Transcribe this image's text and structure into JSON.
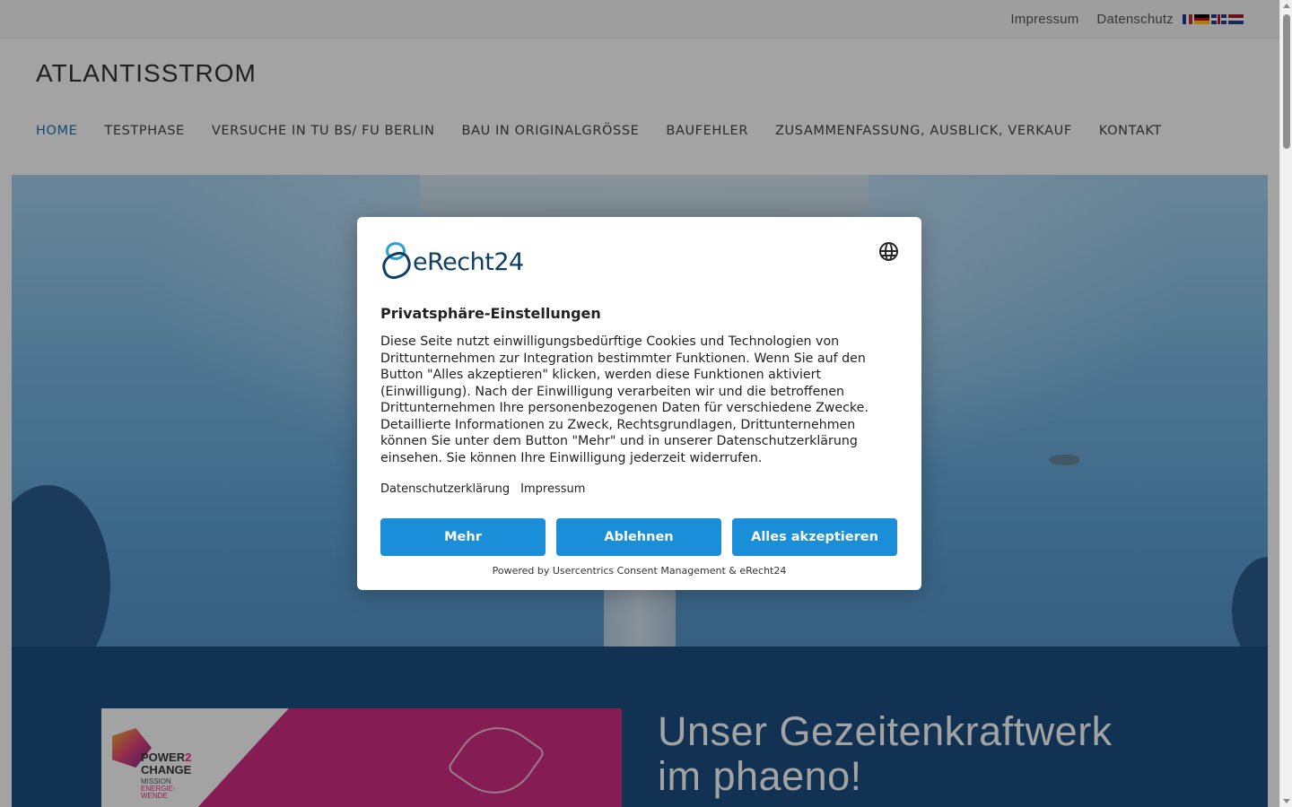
{
  "topbar": {
    "links": [
      "Impressum",
      "Datenschutz"
    ],
    "languages": [
      "fr",
      "de",
      "en",
      "nl"
    ]
  },
  "site": {
    "title": "ATLANTISSTROM"
  },
  "nav": {
    "items": [
      {
        "label": "HOME",
        "active": true
      },
      {
        "label": "TESTPHASE"
      },
      {
        "label": "VERSUCHE IN TU BS/ FU BERLIN"
      },
      {
        "label": "BAU IN ORIGINALGRÖSSE"
      },
      {
        "label": "BAUFEHLER"
      },
      {
        "label": "ZUSAMMENFASSUNG, AUSBLICK, VERKAUF"
      },
      {
        "label": "KONTAKT"
      }
    ]
  },
  "section": {
    "headline_line1": "Unser Gezeitenkraftwerk",
    "headline_line2": "im phaeno!",
    "promo": {
      "brand_line1_a": "POWER",
      "brand_line1_b": "2",
      "brand_line2": "CHANGE",
      "mission_line1": "MISSION",
      "mission_line2": "ENERGIE-",
      "mission_line3": "WENDE"
    }
  },
  "consent": {
    "brand_name": "eRecht24",
    "title": "Privatsphäre-Einstellungen",
    "body": "Diese Seite nutzt einwilligungsbedürftige Cookies und Technologien von Drittunternehmen zur Integration bestimmter Funktionen. Wenn Sie auf den Button \"Alles akzeptieren\" klicken, werden diese Funktionen aktiviert (Einwilligung). Nach der Einwilligung verarbeiten wir und die betroffenen Drittunternehmen Ihre personenbezogenen Daten für verschiedene Zwecke. Detaillierte Informationen zu Zweck, Rechtsgrundlagen, Drittunternehmen können Sie unter dem Button \"Mehr\" und in unserer Datenschutzerklärung einsehen. Sie können Ihre Einwilligung jederzeit widerrufen.",
    "links": [
      "Datenschutzerklärung",
      "Impressum"
    ],
    "buttons": {
      "more": "Mehr",
      "decline": "Ablehnen",
      "accept_all": "Alles akzeptieren"
    },
    "powered_by": "Powered by Usercentrics Consent Management & eRecht24",
    "accent_color": "#1a8ed8",
    "icons": {
      "language": "globe-icon"
    }
  },
  "colors": {
    "nav_active": "#1f75b6",
    "section_bg": "#1b4f80",
    "promo_pink": "#d02e84"
  }
}
